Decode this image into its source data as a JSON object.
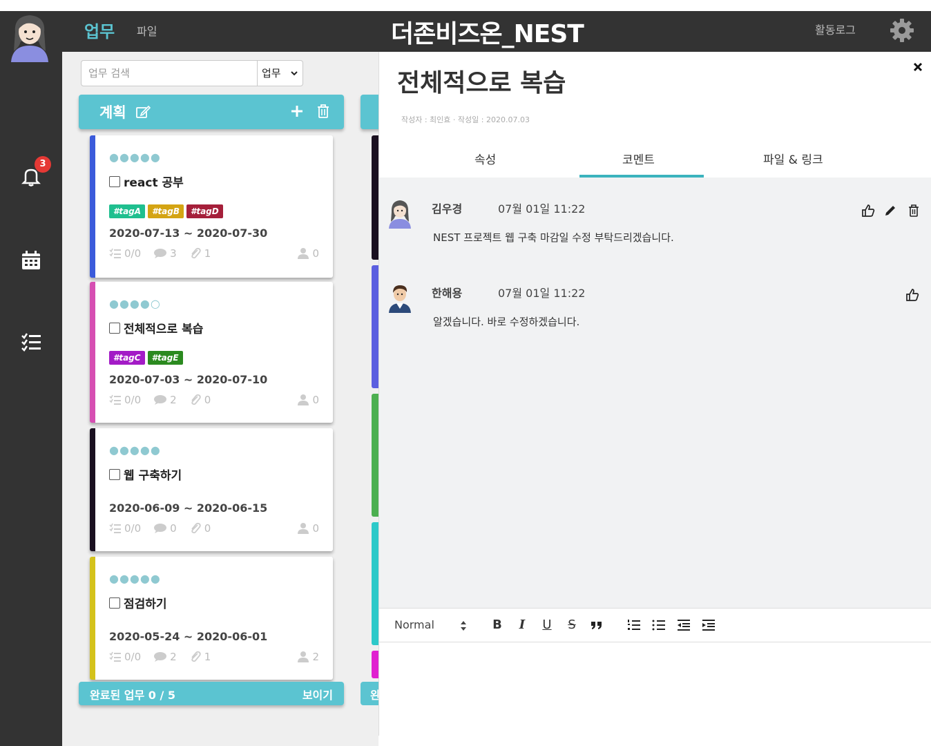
{
  "header": {
    "nav_main": "업무",
    "nav_file": "파일",
    "brand": "더존비즈온_NEST",
    "activity_log": "활동로그"
  },
  "sidebar": {
    "notification_count": "3"
  },
  "board": {
    "search_placeholder": "업무 검색",
    "search_type": "업무",
    "column_title": "계획",
    "footer_done": "완료된 업무 0 / 5",
    "footer_show": "보이기",
    "footer2_text": "완",
    "cards": [
      {
        "stars": "●●●●●",
        "title": "react 공부",
        "tags": [
          {
            "label": "#tagA",
            "color": "#1fbf8f"
          },
          {
            "label": "#tagB",
            "color": "#d4a413"
          },
          {
            "label": "#tagD",
            "color": "#a51f3a"
          }
        ],
        "dates": "2020-07-13 ~ 2020-07-30",
        "checklist": "0/0",
        "comments": "3",
        "files": "1",
        "assignees": "0",
        "border_color": "#3b5bdb"
      },
      {
        "stars": "●●●●○",
        "title": "전체적으로 복습",
        "tags": [
          {
            "label": "#tagC",
            "color": "#a31bc6"
          },
          {
            "label": "#tagE",
            "color": "#2b8a1f"
          }
        ],
        "dates": "2020-07-03 ~ 2020-07-10",
        "checklist": "0/0",
        "comments": "2",
        "files": "0",
        "assignees": "0",
        "border_color": "#d64fb2"
      },
      {
        "stars": "●●●●●",
        "title": "웹 구축하기",
        "tags": [],
        "dates": "2020-06-09 ~ 2020-06-15",
        "checklist": "0/0",
        "comments": "0",
        "files": "0",
        "assignees": "0",
        "border_color": "#1a1020"
      },
      {
        "stars": "●●●●●",
        "title": "점검하기",
        "tags": [],
        "dates": "2020-05-24 ~ 2020-06-01",
        "checklist": "0/0",
        "comments": "2",
        "files": "1",
        "assignees": "2",
        "border_color": "#d4c21b"
      }
    ]
  },
  "panel": {
    "title": "전체적으로 복습",
    "meta": "작성자 : 최인효 ·   작성일 : 2020.07.03",
    "tabs": [
      "속성",
      "코멘트",
      "파일 & 링크"
    ],
    "active_tab": "코멘트",
    "comments": [
      {
        "name": "김우경",
        "time": "07월 01일 11:22",
        "text": "NEST 프로젝트 웹 구축 마감일 수정 부탁드리겠습니다."
      },
      {
        "name": "한해용",
        "time": "07월 01일 11:22",
        "text": "알겠습니다. 바로 수정하겠습니다."
      }
    ],
    "editor": {
      "format": "Normal"
    }
  },
  "colors": {
    "accent": "#5bc4d1",
    "dark": "#333333",
    "tab_active": "#3bb3be"
  }
}
